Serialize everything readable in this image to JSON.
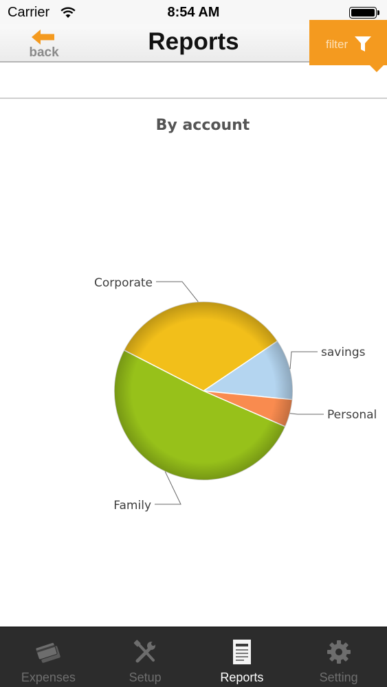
{
  "status_bar": {
    "carrier": "Carrier",
    "time": "8:54 AM"
  },
  "nav": {
    "back_label": "back",
    "title": "Reports",
    "filter_label": "filter"
  },
  "chart_data": {
    "type": "pie",
    "title": "By account",
    "slices": [
      {
        "label": "savings",
        "value": 11,
        "color": "#b4d5f0"
      },
      {
        "label": "Personal",
        "value": 5,
        "color": "#f98b4f"
      },
      {
        "label": "Family",
        "value": 51,
        "color": "#97c11a"
      },
      {
        "label": "Corporate",
        "value": 33,
        "color": "#f2bf1a"
      }
    ]
  },
  "tabs": [
    {
      "label": "Expenses",
      "icon": "credit-card-icon",
      "active": false
    },
    {
      "label": "Setup",
      "icon": "tools-icon",
      "active": false
    },
    {
      "label": "Reports",
      "icon": "report-document-icon",
      "active": true
    },
    {
      "label": "Setting",
      "icon": "gear-icon",
      "active": false
    }
  ],
  "colors": {
    "accent": "#f49a1f",
    "tab_bar": "#2c2c2c"
  }
}
